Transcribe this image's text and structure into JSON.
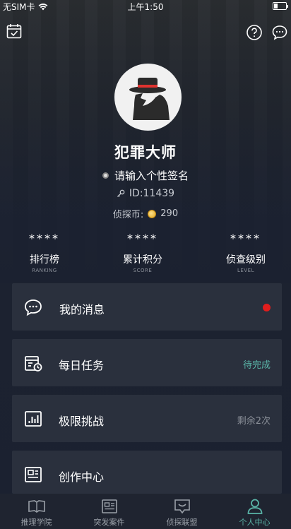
{
  "status_bar": {
    "carrier": "无SIM卡",
    "time": "上午1:50"
  },
  "profile": {
    "nickname": "犯罪大师",
    "signature": "请输入个性签名",
    "user_id": "ID:11439",
    "coins_label": "侦探币:",
    "coins_value": "290"
  },
  "stats": [
    {
      "value": "****",
      "label": "排行榜",
      "sub": "RANKING"
    },
    {
      "value": "****",
      "label": "累计积分",
      "sub": "SCORE"
    },
    {
      "value": "****",
      "label": "侦查级别",
      "sub": "LEVEL"
    }
  ],
  "menu": [
    {
      "label": "我的消息",
      "right": "",
      "icon": "message-icon",
      "has_badge": true
    },
    {
      "label": "每日任务",
      "right": "待完成",
      "icon": "daily-task-icon"
    },
    {
      "label": "极限挑战",
      "right": "剩余2次",
      "icon": "challenge-icon"
    },
    {
      "label": "创作中心",
      "right": "",
      "icon": "creation-icon"
    }
  ],
  "tabs": [
    {
      "label": "推理学院",
      "icon": "book-icon",
      "active": false
    },
    {
      "label": "突发案件",
      "icon": "newspaper-icon",
      "active": false
    },
    {
      "label": "侦探联盟",
      "icon": "chat-bubble-icon",
      "active": false
    },
    {
      "label": "个人中心",
      "icon": "person-icon",
      "active": true
    }
  ],
  "colors": {
    "accent": "#5ab5a8",
    "badge": "#e11d1d",
    "card": "#2a303d",
    "tab_bar": "#1f2430"
  }
}
